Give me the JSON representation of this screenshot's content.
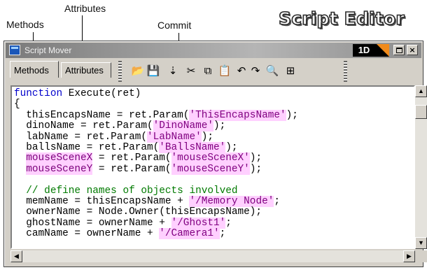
{
  "callouts": {
    "attributes": "Attributes",
    "methods": "Methods",
    "commit": "Commit"
  },
  "brand": "Script Editor",
  "window": {
    "title": "Script Mover",
    "badge": "1D"
  },
  "tabs": [
    {
      "label": "Methods",
      "active": true
    },
    {
      "label": "Attributes",
      "active": false
    }
  ],
  "toolbar": {
    "buttons": [
      {
        "name": "open-folder-icon",
        "glyph": "📂"
      },
      {
        "name": "save-icon",
        "glyph": "💾"
      },
      {
        "name": "commit-icon",
        "glyph": "⇣"
      },
      {
        "name": "cut-icon",
        "glyph": "✂"
      },
      {
        "name": "copy-icon",
        "glyph": "⧉"
      },
      {
        "name": "paste-icon",
        "glyph": "📋"
      },
      {
        "name": "undo-icon",
        "glyph": "↶"
      },
      {
        "name": "redo-icon",
        "glyph": "↷"
      },
      {
        "name": "find-icon",
        "glyph": "🔍"
      },
      {
        "name": "insert-icon",
        "glyph": "⊞"
      }
    ]
  },
  "code_lines": [
    "function Execute(ret)",
    "{",
    "  thisEncapsName = ret.Param('ThisEncapsName');",
    "  dinoName = ret.Param('DinoName');",
    "  labName = ret.Param('LabName');",
    "  ballsName = ret.Param('BallsName');",
    "  mouseSceneX = ret.Param('mouseSceneX');",
    "  mouseSceneY = ret.Param('mouseSceneY');",
    "",
    "  // define names of objects involved",
    "  memName = thisEncapsName + '/Memory Node';",
    "  ownerName = Node.Owner(thisEncapsName);",
    "  ghostName = ownerName + '/Ghost1';",
    "  camName = ownerName + '/Camera1';"
  ],
  "scrollbar_glyphs": {
    "up": "▲",
    "down": "▼",
    "left": "◀",
    "right": "▶"
  }
}
